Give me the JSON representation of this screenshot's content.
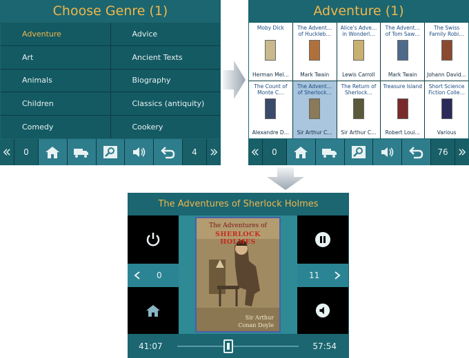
{
  "genre_panel": {
    "title": "Choose Genre (1)",
    "genres": [
      "Adventure",
      "Advice",
      "Art",
      "Ancient Texts",
      "Animals",
      "Biography",
      "Children",
      "Classics (antiquity)",
      "Comedy",
      "Cookery"
    ],
    "active_index": 0,
    "left_count": "0",
    "right_count": "4"
  },
  "book_panel": {
    "title": "Adventure (1)",
    "books": [
      {
        "title": "Moby Dick",
        "author": "Herman Mel…",
        "cover": "#c9b98c"
      },
      {
        "title": "The Advent… of Huckleb…",
        "author": "Mark Twain",
        "cover": "#b0703a"
      },
      {
        "title": "Alice's Adve… in Wonderl…",
        "author": "Lewis Carroll",
        "cover": "#c8b070"
      },
      {
        "title": "The Advent… of Tom Saw…",
        "author": "Mark Twain",
        "cover": "#4e6a8a"
      },
      {
        "title": "The Swiss Family Robi…",
        "author": "Johann David…",
        "cover": "#8a4a30"
      },
      {
        "title": "The Count of Monte C…",
        "author": "Alexandre D…",
        "cover": "#3a4a6a"
      },
      {
        "title": "The Advent… of Sherlock…",
        "author": "Sir Arthur C…",
        "cover": "#8a7a58"
      },
      {
        "title": "The Return of Sherlock…",
        "author": "Sir Arthur C…",
        "cover": "#5a5a3a"
      },
      {
        "title": "Treasure Island",
        "author": "Robert Loui…",
        "cover": "#7a2a2a"
      },
      {
        "title": "Short Science Fiction Colle…",
        "author": "Various",
        "cover": "#2a2a5a"
      }
    ],
    "selected_index": 6,
    "left_count": "0",
    "right_count": "76"
  },
  "player": {
    "title": "The Adventures of Sherlock Holmes",
    "cover_title_line1": "The Adventures of",
    "cover_title_line2": "SHERLOCK HOLMES",
    "cover_author_line1": "Sir Arthur",
    "cover_author_line2": "Conan Doyle",
    "chapter_left": "0",
    "chapter_right": "11",
    "elapsed": "41:07",
    "remaining": "57:54",
    "progress_fraction": 0.42
  },
  "colors": {
    "panel": "#1b6670",
    "accent": "#f0b64c",
    "selected_book": "#a9c6de"
  },
  "icons": [
    "double-left-icon",
    "home-icon",
    "truck-icon",
    "search-icon",
    "speaker-icon",
    "undo-icon",
    "double-right-icon",
    "power-icon",
    "pause-icon",
    "mute-icon",
    "chevron-left-icon",
    "chevron-right-icon",
    "arrow-right-icon",
    "arrow-down-icon"
  ]
}
